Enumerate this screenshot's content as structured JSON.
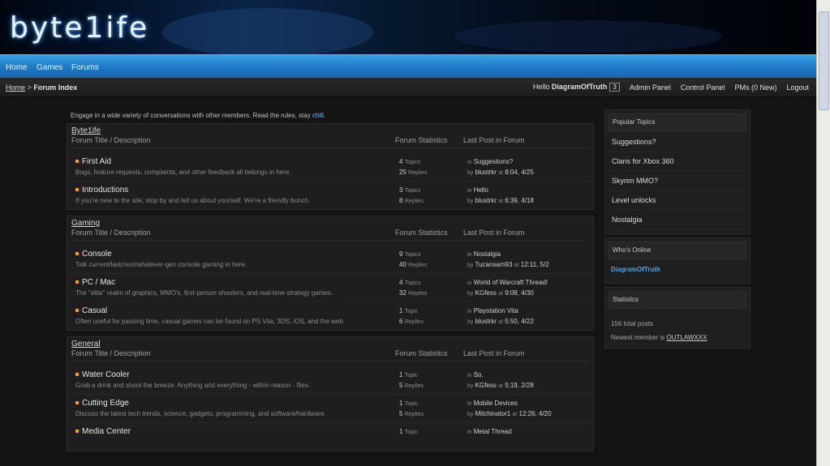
{
  "banner": {
    "logo": "byte1ife"
  },
  "nav": {
    "items": [
      "Home",
      "Games",
      "Forums"
    ]
  },
  "breadcrumb": {
    "home": "Home",
    "separator": ">",
    "current": "Forum Index"
  },
  "userbar": {
    "greeting": "Hello",
    "username": "DiagramOfTruth",
    "badge": "3",
    "admin": "Admin Panel",
    "control": "Control Panel",
    "pms": "PMs (0 New)",
    "logout": "Logout"
  },
  "intro": {
    "text": "Engage in a wide variety of conversations with other members. Read the rules, stay",
    "highlight": "chill",
    "end": "."
  },
  "columns": {
    "title": "Forum Title / Description",
    "stats": "Forum Statistics",
    "last": "Last Post in Forum"
  },
  "categories": [
    {
      "name": "Byte1ife",
      "forums": [
        {
          "name": "First Aid",
          "desc": "Bugs, feature requests, complaints, and other feedback all belongs in here.",
          "topics": "4",
          "topics_label": "Topics",
          "replies": "25",
          "replies_label": "Replies",
          "last_title": "Suggestions?",
          "last_by": "blustrkr",
          "last_time": "8:04, 4/25"
        },
        {
          "name": "Introductions",
          "desc": "If you're new to the site, stop by and tell us about yourself. We're a friendly bunch.",
          "topics": "3",
          "topics_label": "Topics",
          "replies": "8",
          "replies_label": "Replies",
          "last_title": "Hello",
          "last_by": "blustrkr",
          "last_time": "6:39, 4/18"
        }
      ]
    },
    {
      "name": "Gaming",
      "forums": [
        {
          "name": "Console",
          "desc": "Talk current/last/next/whatever-gen console gaming in here.",
          "topics": "9",
          "topics_label": "Topics",
          "replies": "40",
          "replies_label": "Replies",
          "last_title": "Nostalgia",
          "last_by": "Tucansam93",
          "last_time": "12:11, 5/2"
        },
        {
          "name": "PC / Mac",
          "desc": "The \"elite\" realm of graphics, MMO's, first-person shooters, and real-time strategy games.",
          "topics": "4",
          "topics_label": "Topics",
          "replies": "32",
          "replies_label": "Replies",
          "last_title": "World of Warcraft Thread!",
          "last_by": "KGfess",
          "last_time": "9:08, 4/30"
        },
        {
          "name": "Casual",
          "desc": "Often useful for passing time, casual games can be found on PS Vita, 3DS, iOS, and the web.",
          "topics": "1",
          "topics_label": "Topic",
          "replies": "6",
          "replies_label": "Replies",
          "last_title": "Playstation Vita",
          "last_by": "blustrkr",
          "last_time": "5:50, 4/22"
        }
      ]
    },
    {
      "name": "General",
      "forums": [
        {
          "name": "Water Cooler",
          "desc": "Grab a drink and shoot the breeze. Anything and everything - within reason - flies.",
          "topics": "1",
          "topics_label": "Topic",
          "replies": "5",
          "replies_label": "Replies",
          "last_title": "So.",
          "last_by": "KGfess",
          "last_time": "5:19, 2/28"
        },
        {
          "name": "Cutting Edge",
          "desc": "Discuss the latest tech trends, science, gadgets, programming, and software/hardware.",
          "topics": "1",
          "topics_label": "Topic",
          "replies": "5",
          "replies_label": "Replies",
          "last_title": "Mobile Devices",
          "last_by": "Mitchinator1",
          "last_time": "12:26, 4/20"
        },
        {
          "name": "Media Center",
          "desc": "",
          "topics": "1",
          "topics_label": "Topic",
          "replies": "",
          "replies_label": "",
          "last_title": "Metal Thread",
          "last_by": "",
          "last_time": ""
        }
      ]
    }
  ],
  "sidebar": {
    "popular": {
      "title": "Popular Topics",
      "items": [
        "Suggestions?",
        "Clans for Xbox 360",
        "Skyrim MMO?",
        "Level unlocks",
        "Nostalgia"
      ]
    },
    "online": {
      "title": "Who's Online",
      "user": "DiagramOfTruth"
    },
    "stats": {
      "title": "Statistics",
      "posts": "156 total posts",
      "newest_label": "Newest member is",
      "newest": "OUTLAWXXX"
    }
  },
  "words": {
    "in": "in",
    "by": "by",
    "at": "at"
  }
}
